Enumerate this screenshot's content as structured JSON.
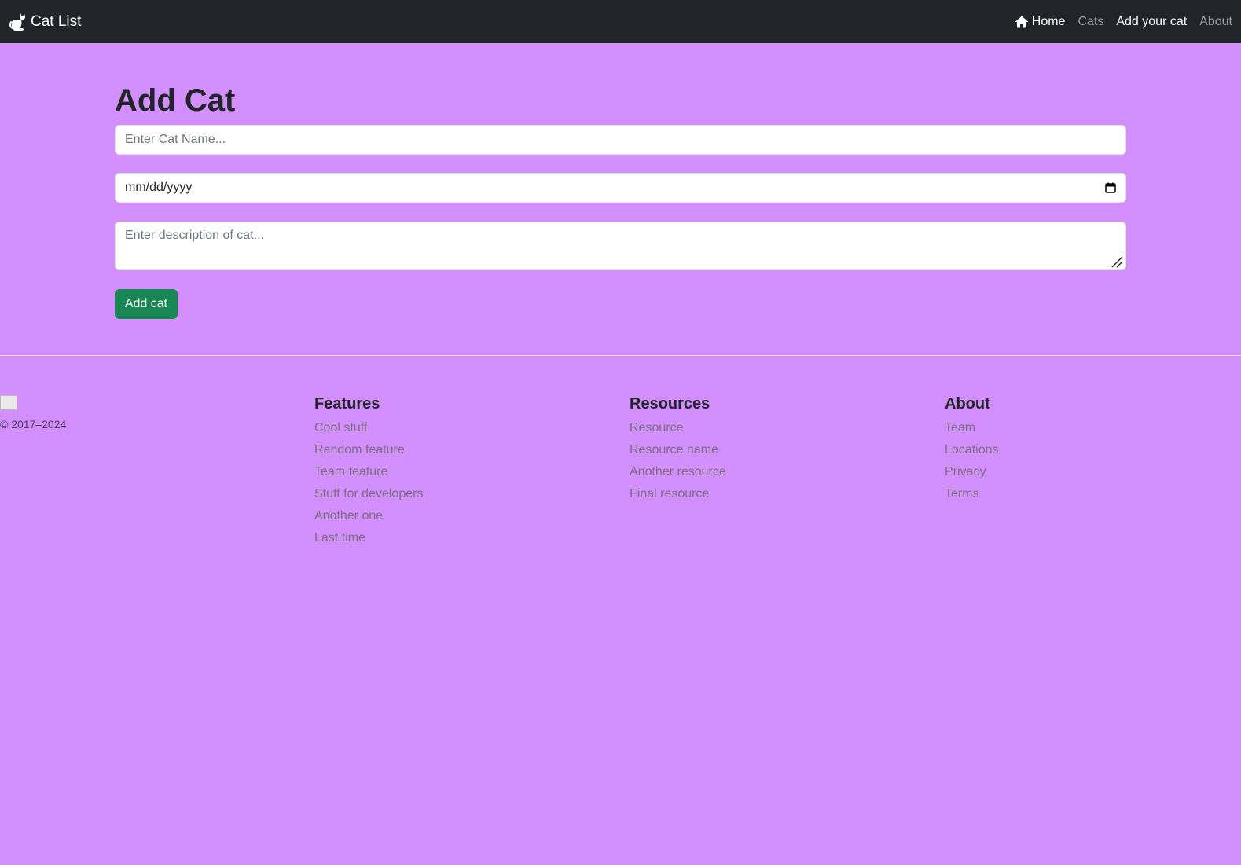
{
  "navbar": {
    "brand": "Cat List",
    "links": [
      {
        "label": "Home",
        "icon": "house-icon"
      },
      {
        "label": "Cats"
      },
      {
        "label": "Add your cat"
      },
      {
        "label": "About"
      }
    ]
  },
  "form": {
    "title": "Add Cat",
    "name_placeholder": "Enter Cat Name...",
    "date_value": "mm/dd/yyyy",
    "description_placeholder": "Enter description of cat...",
    "submit_label": "Add cat"
  },
  "footer": {
    "copyright": "© 2017–2024",
    "features": {
      "heading": "Features",
      "items": [
        "Cool stuff",
        "Random feature",
        "Team feature",
        "Stuff for developers",
        "Another one",
        "Last time"
      ]
    },
    "resources": {
      "heading": "Resources",
      "items": [
        "Resource",
        "Resource name",
        "Another resource",
        "Final resource"
      ]
    },
    "about": {
      "heading": "About",
      "items": [
        "Team",
        "Locations",
        "Privacy",
        "Terms"
      ]
    }
  },
  "colors": {
    "page_background": "#d38ffd",
    "navbar_background": "#212529",
    "button_green": "#198754"
  }
}
